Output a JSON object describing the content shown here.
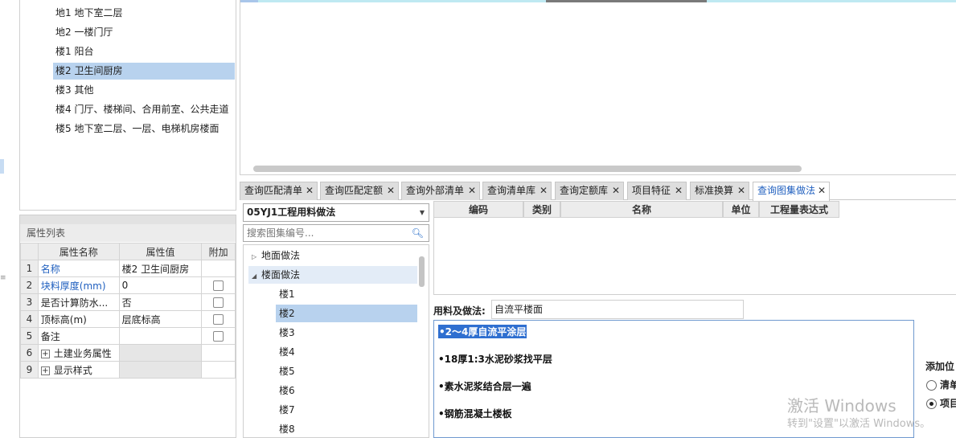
{
  "tree": {
    "items": [
      "地1  地下室二层",
      "地2  一楼门厅",
      "楼1  阳台",
      "楼2  卫生间厨房",
      "楼3  其他",
      "楼4  门厅、楼梯间、合用前室、公共走道",
      "楼5 地下室二层、一层、电梯机房楼面"
    ],
    "selected_index": 3
  },
  "properties": {
    "title": "属性列表",
    "headers": [
      "属性名称",
      "属性值",
      "附加"
    ],
    "rows": [
      {
        "num": "1",
        "name": "名称",
        "value": "楼2  卫生间厨房"
      },
      {
        "num": "2",
        "name": "块料厚度(mm)",
        "value": "0"
      },
      {
        "num": "3",
        "name": "是否计算防水...",
        "value": "否"
      },
      {
        "num": "4",
        "name": "顶标高(m)",
        "value": "层底标高"
      },
      {
        "num": "5",
        "name": "备注",
        "value": ""
      },
      {
        "num": "6",
        "name": "土建业务属性",
        "value": ""
      },
      {
        "num": "9",
        "name": "显示样式",
        "value": ""
      }
    ]
  },
  "tabs": [
    {
      "label": "查询匹配清单"
    },
    {
      "label": "查询匹配定额"
    },
    {
      "label": "查询外部清单"
    },
    {
      "label": "查询清单库"
    },
    {
      "label": "查询定额库"
    },
    {
      "label": "项目特征"
    },
    {
      "label": "标准换算"
    },
    {
      "label": "查询图集做法"
    }
  ],
  "active_tab": 7,
  "atlas": {
    "selected": "05YJ1工程用料做法",
    "search_placeholder": "搜索图集编号...",
    "groups": [
      "地面做法",
      "楼面做法"
    ],
    "children": [
      "楼1",
      "楼2",
      "楼3",
      "楼4",
      "楼5",
      "楼6",
      "楼7",
      "楼8"
    ],
    "selected_child": 1
  },
  "result_table": {
    "headers": [
      "编码",
      "类别",
      "名称",
      "单位",
      "工程量表达式"
    ]
  },
  "material": {
    "label": "用料及做法:",
    "value": "自流平楼面",
    "lines": [
      "•2～4厚自流平涂层",
      "•18厚1:3水泥砂浆找平层",
      "•素水泥浆结合层一遍",
      "•钢筋混凝土楼板"
    ]
  },
  "add_position": {
    "label": "添加位",
    "options": [
      "清单",
      "项目"
    ],
    "selected": 1
  },
  "watermark": {
    "line1": "激活 Windows",
    "line2": "转到\"设置\"以激活 Windows。"
  }
}
